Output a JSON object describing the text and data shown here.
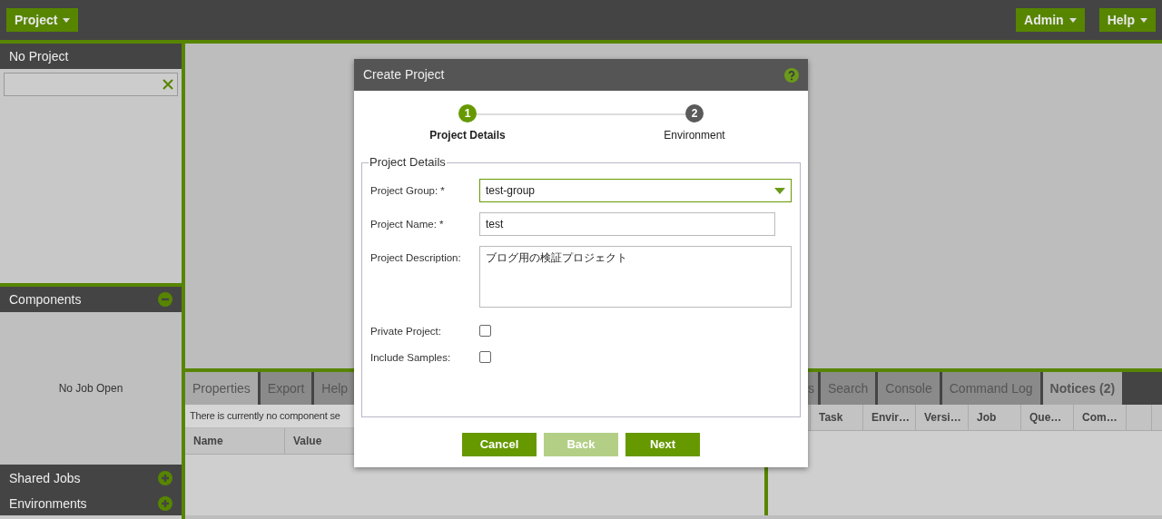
{
  "top_bar": {
    "left_menus": [
      {
        "label": "Project"
      }
    ],
    "right_menus": [
      {
        "label": "Admin"
      },
      {
        "label": "Help"
      }
    ]
  },
  "sidebar": {
    "project_title": "No Project",
    "sections": [
      {
        "title": "Components",
        "expanded": true,
        "body": "No Job Open"
      },
      {
        "title": "Shared Jobs",
        "expanded": false
      },
      {
        "title": "Environments",
        "expanded": false
      }
    ]
  },
  "properties_panel": {
    "tabs": [
      {
        "label": "Properties",
        "selected": true
      },
      {
        "label": "Export",
        "selected": false
      },
      {
        "label": "Help",
        "selected": false
      }
    ],
    "message": "There is currently no component se",
    "columns": [
      "Name",
      "Value"
    ]
  },
  "tasks_panel": {
    "tabs": [
      {
        "label": "s",
        "selected": false
      },
      {
        "label": "Search",
        "selected": false
      },
      {
        "label": "Console",
        "selected": false
      },
      {
        "label": "Command Log",
        "selected": false
      },
      {
        "label": "Notices (2)",
        "selected": true
      }
    ],
    "columns": [
      "Task",
      "Envir…",
      "Versi…",
      "Job",
      "Que…",
      "Com…"
    ]
  },
  "dialog": {
    "title": "Create Project",
    "steps": [
      {
        "number": "1",
        "label": "Project Details",
        "selected": true
      },
      {
        "number": "2",
        "label": "Environment",
        "selected": false
      }
    ],
    "legend": "Project Details",
    "fields": [
      {
        "kind": "select",
        "label": "Project Group: *",
        "value": "test-group",
        "focused": true
      },
      {
        "kind": "text",
        "label": "Project Name: *",
        "value": "test",
        "focused": false
      },
      {
        "kind": "textarea",
        "label": "Project Description:",
        "value": "ブログ用の検証プロジェクト",
        "focused": false
      },
      {
        "kind": "checkbox",
        "label": "Private Project:",
        "checked": false
      },
      {
        "kind": "checkbox",
        "label": "Include Samples:",
        "checked": false
      }
    ],
    "buttons": [
      {
        "label": "Cancel",
        "disabled": false
      },
      {
        "label": "Back",
        "disabled": true
      },
      {
        "label": "Next",
        "disabled": false
      }
    ]
  }
}
